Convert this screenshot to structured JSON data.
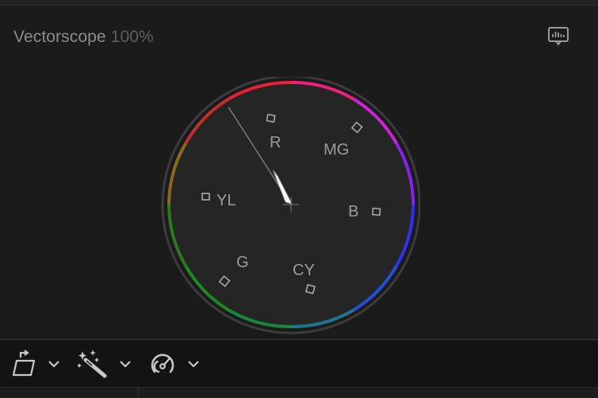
{
  "scope": {
    "title": "Vectorscope",
    "zoom": "100%",
    "labels": {
      "r": "R",
      "mg": "MG",
      "yl": "YL",
      "b": "B",
      "g": "G",
      "cy": "CY"
    }
  },
  "icons": {
    "scope_settings": "scope-settings-icon",
    "transform": "transform-icon",
    "enhance": "magic-wand-icon",
    "retime": "speedometer-icon",
    "chevron": "chevron-down-icon"
  },
  "colors": {
    "background": "#1b1b1b",
    "scope_bg": "#252525",
    "label": "#9b9b9b",
    "trace": "#ffffff"
  }
}
